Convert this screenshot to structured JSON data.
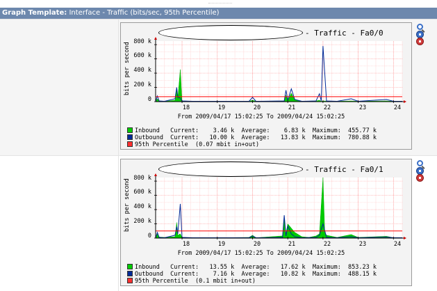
{
  "header": {
    "label": "Graph Template:",
    "value": "Interface - Traffic (bits/sec, 95th Percentile)"
  },
  "colors": {
    "header_bg": "#6d88ad",
    "inbound": "#00cc00",
    "outbound": "#002a97",
    "percentile": "#ff0000",
    "grid": "#ffaaaa"
  },
  "icons": [
    "zoom-icon",
    "add-blue-icon",
    "remove-red-icon"
  ],
  "graphs": [
    {
      "title": "- Traffic - Fa0/0",
      "ylabel": "bits per second",
      "yticks": [
        "800 k",
        "600 k",
        "400 k",
        "200 k",
        "0"
      ],
      "xticks": [
        "18",
        "19",
        "20",
        "21",
        "22",
        "23",
        "24"
      ],
      "range": "From 2009/04/17 15:02:25 To 2009/04/24 15:02:25",
      "legend": {
        "inbound": "Inbound   Current:    3.46 k  Average:    6.83 k  Maximum:  455.77 k",
        "outbound": "Outbound  Current:   10.00 k  Average:   13.83 k  Maximum:  780.88 k",
        "percentile": "95th Percentile  (0.07 mbit in+out)"
      }
    },
    {
      "title": "- Traffic - Fa0/1",
      "ylabel": "bits per second",
      "yticks": [
        "800 k",
        "600 k",
        "400 k",
        "200 k",
        "0"
      ],
      "xticks": [
        "18",
        "19",
        "20",
        "21",
        "22",
        "23",
        "24"
      ],
      "range": "From 2009/04/17 15:02:25 To 2009/04/24 15:02:25",
      "legend": {
        "inbound": "Inbound   Current:   13.55 k  Average:   17.62 k  Maximum:  853.23 k",
        "outbound": "Outbound  Current:    7.16 k  Average:   10.82 k  Maximum:  488.15 k",
        "percentile": "95th Percentile  (0.1 mbit in+out)"
      }
    }
  ],
  "chart_data": [
    {
      "type": "area",
      "title": "- Traffic - Fa0/0",
      "ylabel": "bits per second",
      "ylim": [
        0,
        850
      ],
      "xlim": [
        17.25,
        24.25
      ],
      "percentile_k": 70,
      "series": [
        {
          "name": "Inbound",
          "points": [
            [
              17.25,
              0
            ],
            [
              17.3,
              40
            ],
            [
              17.35,
              10
            ],
            [
              17.5,
              5
            ],
            [
              17.8,
              20
            ],
            [
              17.85,
              170
            ],
            [
              17.88,
              40
            ],
            [
              17.95,
              450
            ],
            [
              18.0,
              10
            ],
            [
              18.3,
              5
            ],
            [
              19.0,
              5
            ],
            [
              19.9,
              5
            ],
            [
              20.0,
              20
            ],
            [
              20.1,
              5
            ],
            [
              20.9,
              10
            ],
            [
              20.95,
              90
            ],
            [
              21.0,
              15
            ],
            [
              21.1,
              120
            ],
            [
              21.2,
              25
            ],
            [
              21.4,
              5
            ],
            [
              21.8,
              10
            ],
            [
              21.9,
              20
            ],
            [
              21.95,
              5
            ],
            [
              22.0,
              10
            ],
            [
              22.4,
              5
            ],
            [
              22.8,
              10
            ],
            [
              23.0,
              5
            ],
            [
              23.8,
              10
            ],
            [
              24.0,
              5
            ],
            [
              24.25,
              5
            ]
          ]
        },
        {
          "name": "Outbound",
          "points": [
            [
              17.25,
              0
            ],
            [
              17.3,
              80
            ],
            [
              17.35,
              10
            ],
            [
              17.5,
              5
            ],
            [
              17.8,
              40
            ],
            [
              17.85,
              200
            ],
            [
              17.88,
              60
            ],
            [
              17.95,
              50
            ],
            [
              18.0,
              10
            ],
            [
              18.3,
              5
            ],
            [
              19.0,
              5
            ],
            [
              19.9,
              5
            ],
            [
              20.0,
              60
            ],
            [
              20.1,
              5
            ],
            [
              20.9,
              10
            ],
            [
              20.95,
              160
            ],
            [
              21.0,
              20
            ],
            [
              21.1,
              180
            ],
            [
              21.2,
              30
            ],
            [
              21.4,
              5
            ],
            [
              21.8,
              10
            ],
            [
              21.9,
              110
            ],
            [
              21.95,
              10
            ],
            [
              22.0,
              780
            ],
            [
              22.1,
              10
            ],
            [
              22.4,
              5
            ],
            [
              22.8,
              40
            ],
            [
              23.0,
              5
            ],
            [
              23.8,
              30
            ],
            [
              24.0,
              5
            ],
            [
              24.25,
              5
            ]
          ]
        }
      ]
    },
    {
      "type": "area",
      "title": "- Traffic - Fa0/1",
      "ylabel": "bits per second",
      "ylim": [
        0,
        850
      ],
      "xlim": [
        17.25,
        24.25
      ],
      "percentile_k": 100,
      "series": [
        {
          "name": "Inbound",
          "points": [
            [
              17.25,
              0
            ],
            [
              17.3,
              60
            ],
            [
              17.35,
              15
            ],
            [
              17.5,
              10
            ],
            [
              17.8,
              20
            ],
            [
              17.85,
              220
            ],
            [
              17.88,
              40
            ],
            [
              17.95,
              60
            ],
            [
              18.0,
              10
            ],
            [
              18.3,
              5
            ],
            [
              19.0,
              5
            ],
            [
              19.9,
              10
            ],
            [
              20.0,
              40
            ],
            [
              20.1,
              5
            ],
            [
              20.85,
              30
            ],
            [
              20.9,
              260
            ],
            [
              20.95,
              60
            ],
            [
              21.0,
              200
            ],
            [
              21.1,
              140
            ],
            [
              21.2,
              80
            ],
            [
              21.4,
              20
            ],
            [
              21.6,
              10
            ],
            [
              21.8,
              30
            ],
            [
              21.9,
              60
            ],
            [
              22.0,
              850
            ],
            [
              22.05,
              80
            ],
            [
              22.1,
              40
            ],
            [
              22.4,
              10
            ],
            [
              22.8,
              50
            ],
            [
              23.0,
              10
            ],
            [
              23.8,
              25
            ],
            [
              24.0,
              5
            ],
            [
              24.25,
              5
            ]
          ]
        },
        {
          "name": "Outbound",
          "points": [
            [
              17.25,
              0
            ],
            [
              17.3,
              80
            ],
            [
              17.35,
              10
            ],
            [
              17.5,
              5
            ],
            [
              17.8,
              40
            ],
            [
              17.85,
              160
            ],
            [
              17.88,
              60
            ],
            [
              17.95,
              480
            ],
            [
              18.0,
              10
            ],
            [
              18.3,
              5
            ],
            [
              19.0,
              5
            ],
            [
              19.9,
              5
            ],
            [
              20.0,
              30
            ],
            [
              20.1,
              5
            ],
            [
              20.85,
              10
            ],
            [
              20.9,
              320
            ],
            [
              20.95,
              30
            ],
            [
              21.0,
              170
            ],
            [
              21.1,
              60
            ],
            [
              21.2,
              20
            ],
            [
              21.4,
              5
            ],
            [
              21.8,
              10
            ],
            [
              21.9,
              40
            ],
            [
              22.0,
              200
            ],
            [
              22.1,
              10
            ],
            [
              22.4,
              5
            ],
            [
              22.8,
              20
            ],
            [
              23.0,
              5
            ],
            [
              23.8,
              15
            ],
            [
              24.0,
              5
            ],
            [
              24.25,
              5
            ]
          ]
        }
      ]
    }
  ]
}
